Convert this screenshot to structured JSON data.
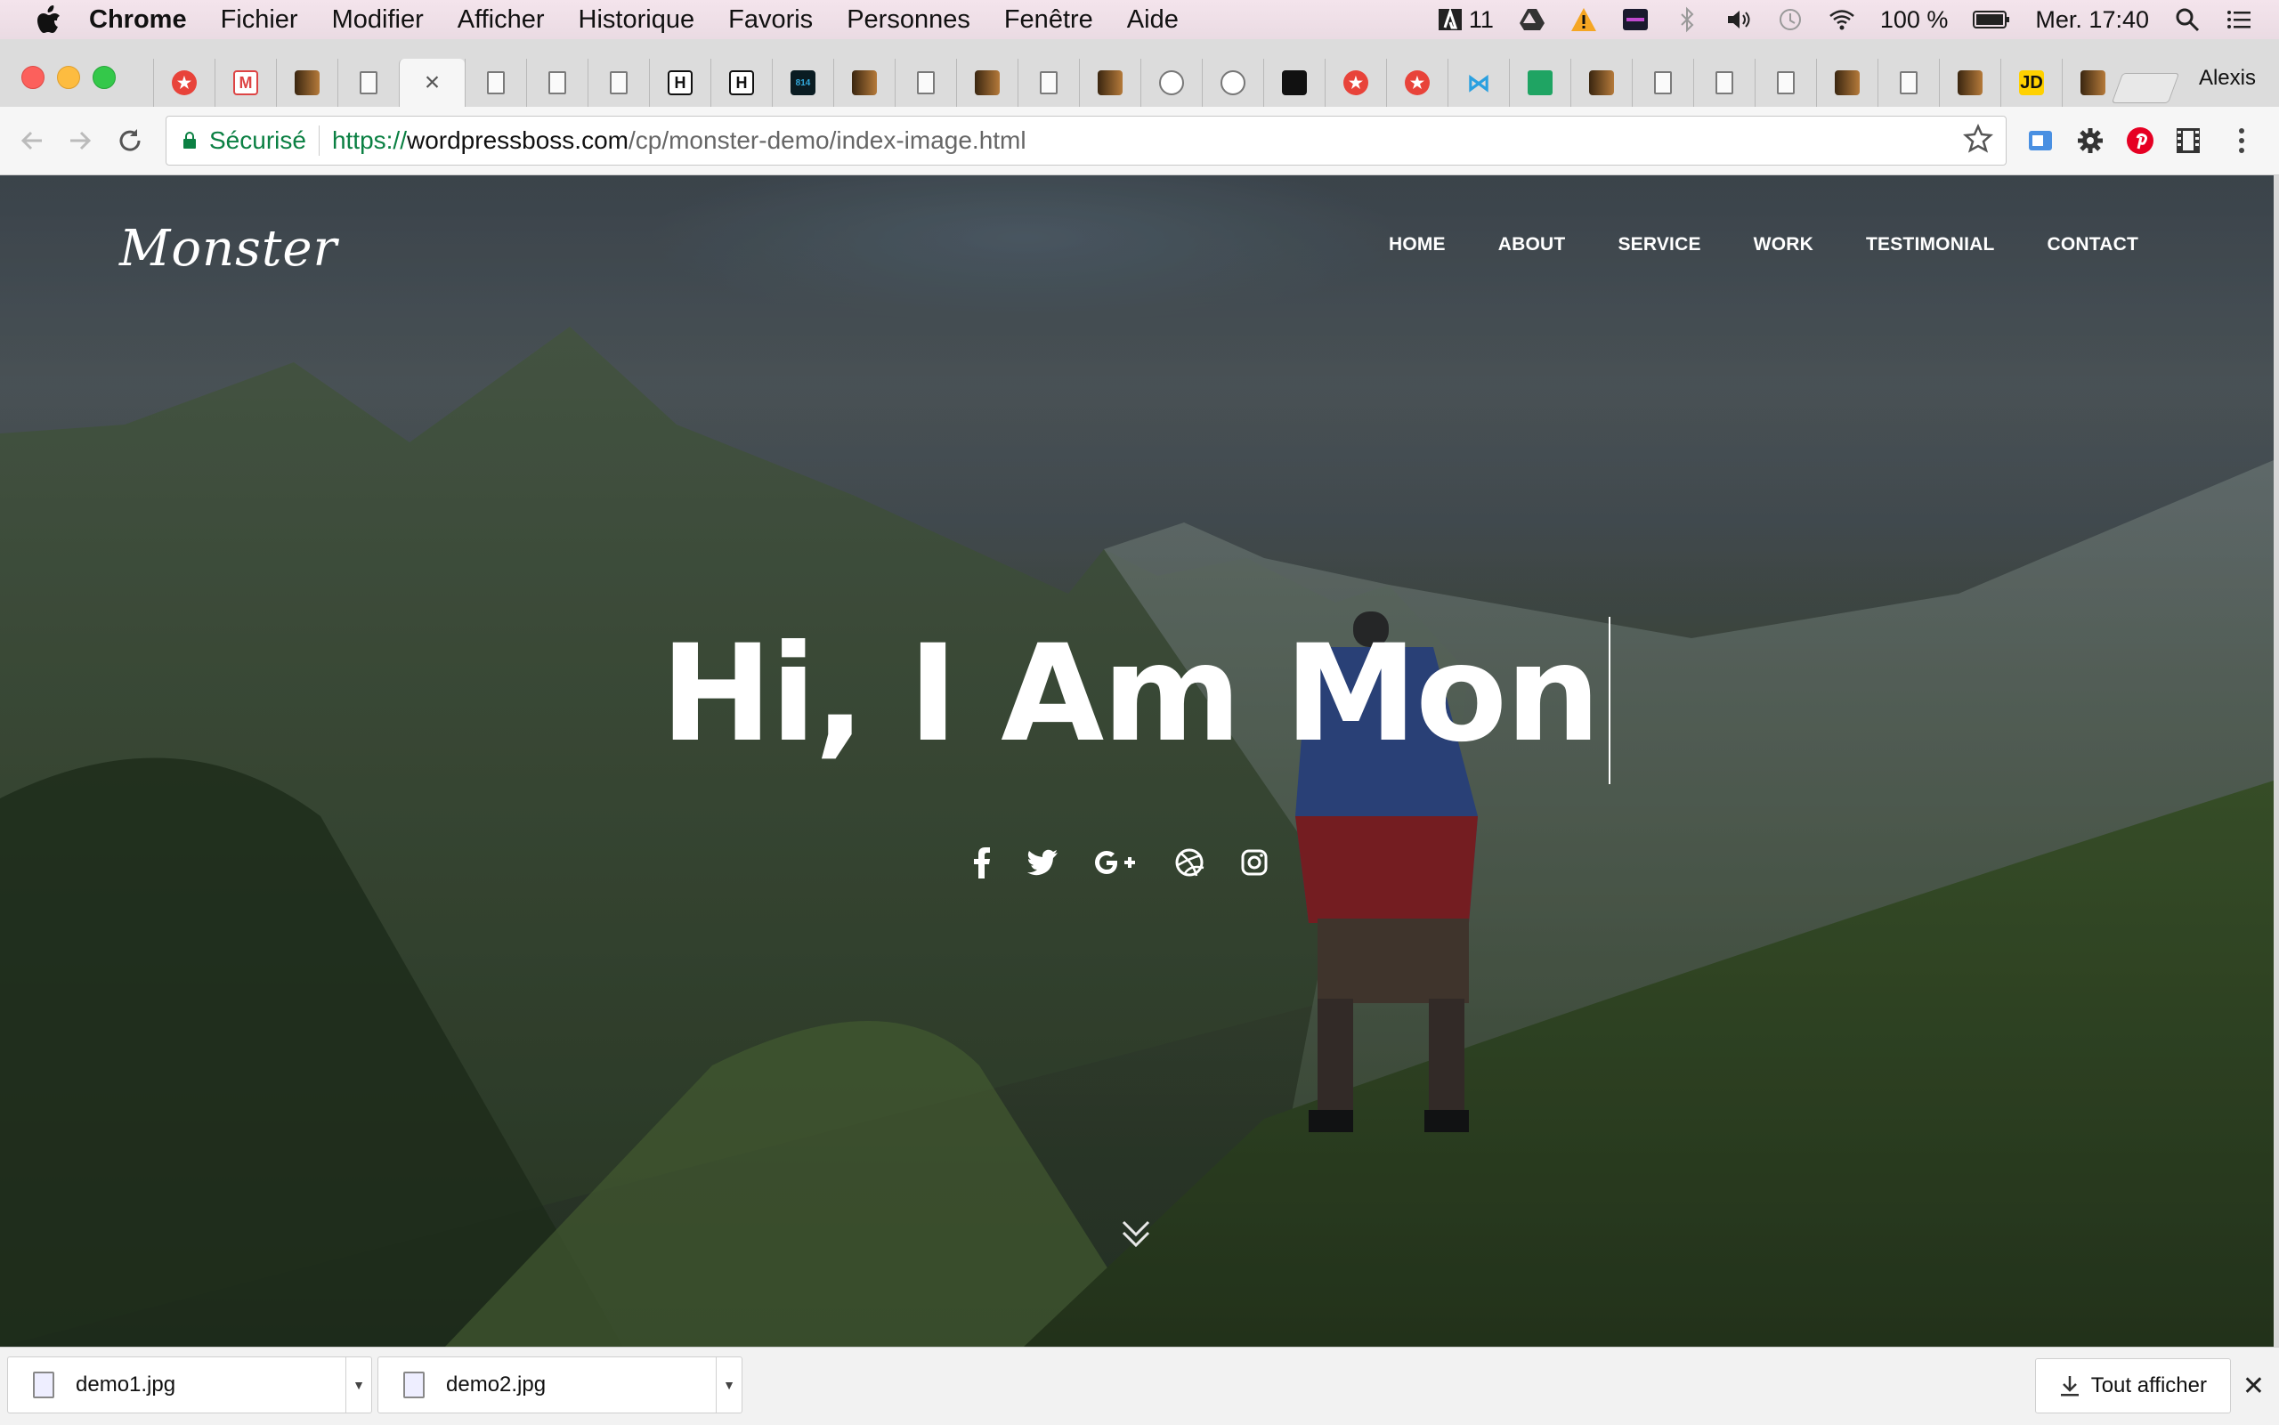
{
  "menubar": {
    "app_name": "Chrome",
    "items": [
      "Fichier",
      "Modifier",
      "Afficher",
      "Historique",
      "Favoris",
      "Personnes",
      "Fenêtre",
      "Aide"
    ],
    "adobe_count": "11",
    "battery": "100 %",
    "clock": "Mer. 17:40"
  },
  "browser": {
    "profile_name": "Alexis",
    "secure_label": "Sécurisé",
    "url_scheme": "https://",
    "url_host": "wordpressboss.com",
    "url_path": "/cp/monster-demo/index-image.html",
    "tabs": [
      {
        "icon": "red-star-icon"
      },
      {
        "icon": "gmail-icon"
      },
      {
        "icon": "book-cover-icon"
      },
      {
        "icon": "page-icon"
      },
      {
        "icon": "close-icon",
        "active": true
      },
      {
        "icon": "page-icon"
      },
      {
        "icon": "page-icon"
      },
      {
        "icon": "page-icon"
      },
      {
        "icon": "h-icon"
      },
      {
        "icon": "h-icon"
      },
      {
        "icon": "dark-app-icon"
      },
      {
        "icon": "book-cover-icon"
      },
      {
        "icon": "page-icon"
      },
      {
        "icon": "book-cover-icon"
      },
      {
        "icon": "page-icon"
      },
      {
        "icon": "book-cover-icon"
      },
      {
        "icon": "face-icon"
      },
      {
        "icon": "face-icon"
      },
      {
        "icon": "target-icon"
      },
      {
        "icon": "red-star-icon"
      },
      {
        "icon": "red-star-icon"
      },
      {
        "icon": "share-network-icon"
      },
      {
        "icon": "spreadsheet-icon"
      },
      {
        "icon": "book-cover-icon"
      },
      {
        "icon": "page-icon"
      },
      {
        "icon": "page-icon"
      },
      {
        "icon": "page-icon"
      },
      {
        "icon": "book-cover-icon"
      },
      {
        "icon": "page-icon"
      },
      {
        "icon": "book-cover-icon"
      },
      {
        "icon": "jd-icon"
      },
      {
        "icon": "book-cover-icon"
      }
    ]
  },
  "site": {
    "logo": "Monster",
    "nav": [
      "HOME",
      "ABOUT",
      "SERVICE",
      "WORK",
      "TESTIMONIAL",
      "CONTACT"
    ],
    "headline": "Hi, I Am Mon",
    "socials": [
      "facebook-icon",
      "twitter-icon",
      "google-plus-icon",
      "dribbble-icon",
      "instagram-icon"
    ],
    "scroll_icon": "double-chevron-down-icon"
  },
  "downloads": {
    "items": [
      "demo1.jpg",
      "demo2.jpg"
    ],
    "show_all_label": "Tout afficher"
  },
  "colors": {
    "secure_green": "#0b8043",
    "close_red": "#fc605c",
    "minimize_yellow": "#fdbc40",
    "maximize_green": "#34c84a"
  }
}
